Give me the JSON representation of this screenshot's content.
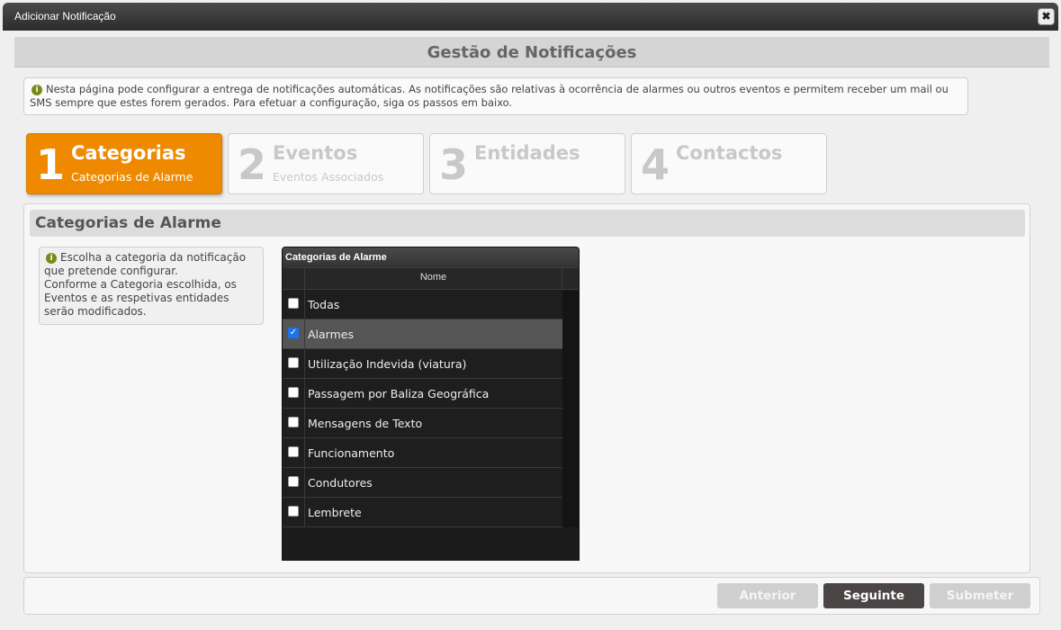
{
  "window": {
    "title": "Adicionar Notificação",
    "close_glyph": "✖"
  },
  "page": {
    "title": "Gestão de Notificações"
  },
  "intro": {
    "icon": "i",
    "text": "Nesta página pode configurar a entrega de notificações automáticas. As notificações são relativas à ocorrência de alarmes ou outros eventos e permitem receber um mail ou SMS sempre que estes forem gerados. Para efetuar a configuração, siga os passos em baixo."
  },
  "steps": [
    {
      "number": "1",
      "title": "Categorias",
      "subtitle": "Categorias de Alarme",
      "active": true
    },
    {
      "number": "2",
      "title": "Eventos",
      "subtitle": "Eventos Associados",
      "active": false
    },
    {
      "number": "3",
      "title": "Entidades",
      "subtitle": "",
      "active": false
    },
    {
      "number": "4",
      "title": "Contactos",
      "subtitle": "",
      "active": false
    }
  ],
  "section": {
    "title": "Categorias de Alarme",
    "help": {
      "icon": "i",
      "line1": "Escolha a categoria da notificação que pretende configurar.",
      "line2": "Conforme a Categoria escolhida, os Eventos e as respetivas entidades serão modificados."
    }
  },
  "grid": {
    "caption": "Categorias de Alarme",
    "column_header": "Nome",
    "check_glyph": "✓",
    "rows": [
      {
        "label": "Todas",
        "checked": false,
        "selected": false
      },
      {
        "label": "Alarmes",
        "checked": true,
        "selected": true
      },
      {
        "label": "Utilização Indevida (viatura)",
        "checked": false,
        "selected": false
      },
      {
        "label": "Passagem por Baliza Geográfica",
        "checked": false,
        "selected": false
      },
      {
        "label": "Mensagens de Texto",
        "checked": false,
        "selected": false
      },
      {
        "label": "Funcionamento",
        "checked": false,
        "selected": false
      },
      {
        "label": "Condutores",
        "checked": false,
        "selected": false
      },
      {
        "label": "Lembrete",
        "checked": false,
        "selected": false
      }
    ]
  },
  "footer": {
    "previous_label": "Anterior",
    "next_label": "Seguinte",
    "submit_label": "Submeter"
  }
}
